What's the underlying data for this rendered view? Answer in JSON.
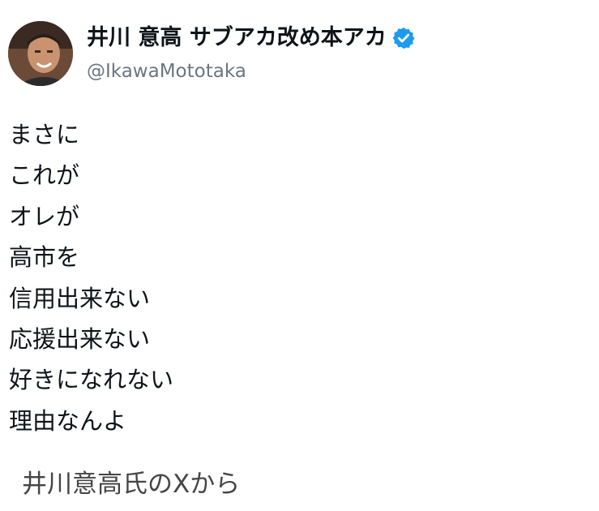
{
  "post": {
    "author": {
      "display_name": "井川 意高 サブアカ改め本アカ",
      "handle": "@IkawaMototaka",
      "verified": true,
      "avatar_icon": "profile-photo",
      "verified_icon": "verified-badge-icon",
      "verified_color": "#1d9bf0"
    },
    "lines": [
      "まさに",
      "これが",
      "オレが",
      "高市を",
      "信用出来ない",
      "応援出来ない",
      "好きになれない",
      "理由なんよ"
    ]
  },
  "caption": "井川意高氏のXから"
}
